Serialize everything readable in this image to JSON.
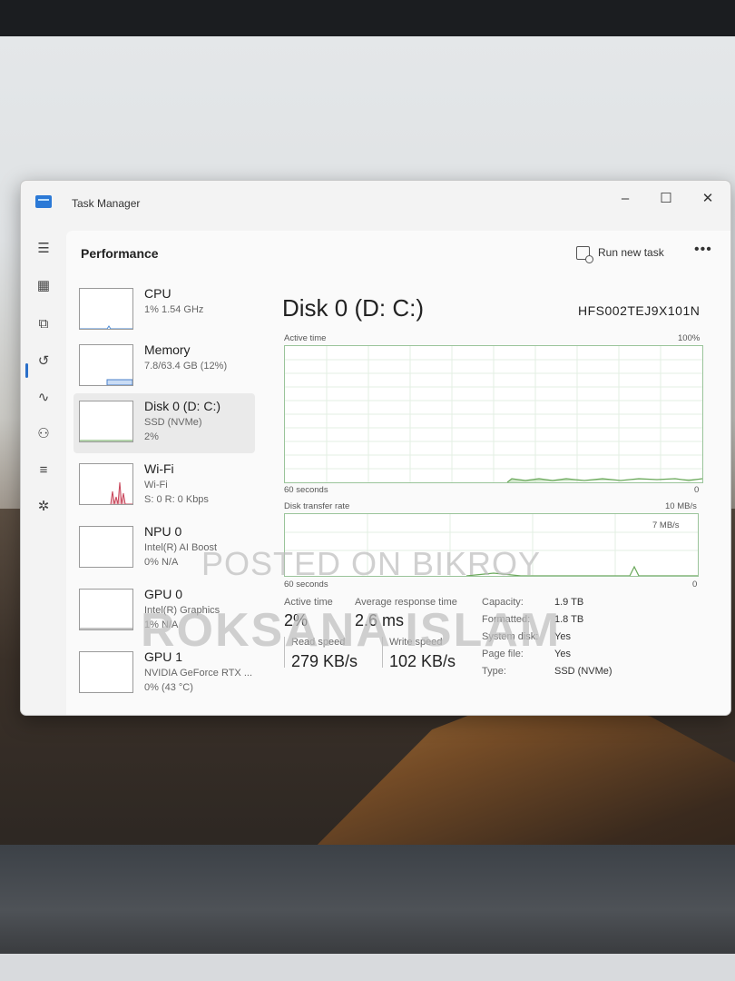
{
  "window": {
    "title": "Task Manager",
    "controls": {
      "minimize": "–",
      "maximize": "☐",
      "close": "✕"
    }
  },
  "header": {
    "title": "Performance",
    "run_new_task": "Run new task",
    "more": "•••"
  },
  "rail": {
    "items": [
      {
        "icon": "hamburger-icon",
        "glyph": "☰"
      },
      {
        "icon": "processes-icon",
        "glyph": "▦"
      },
      {
        "icon": "performance-icon",
        "glyph": "⧉"
      },
      {
        "icon": "app-history-icon",
        "glyph": "↺"
      },
      {
        "icon": "startup-apps-icon",
        "glyph": "∿"
      },
      {
        "icon": "users-icon",
        "glyph": "⚇"
      },
      {
        "icon": "details-icon",
        "glyph": "≡"
      },
      {
        "icon": "services-icon",
        "glyph": "✲"
      }
    ],
    "settings_glyph": "⚙"
  },
  "devices": [
    {
      "name": "CPU",
      "sub": "1% 1.54 GHz",
      "sub2": ""
    },
    {
      "name": "Memory",
      "sub": "7.8/63.4 GB (12%)",
      "sub2": ""
    },
    {
      "name": "Disk 0 (D: C:)",
      "sub": "SSD (NVMe)",
      "sub2": "2%"
    },
    {
      "name": "Wi-Fi",
      "sub": "Wi-Fi",
      "sub2": "S: 0 R: 0 Kbps"
    },
    {
      "name": "NPU 0",
      "sub": "Intel(R) AI Boost",
      "sub2": "0% N/A"
    },
    {
      "name": "GPU 0",
      "sub": "Intel(R) Graphics",
      "sub2": "1% N/A"
    },
    {
      "name": "GPU 1",
      "sub": "NVIDIA GeForce RTX ...",
      "sub2": "0% (43 °C)"
    }
  ],
  "detail": {
    "title": "Disk 0 (D: C:)",
    "model": "HFS002TEJ9X101N",
    "active_time_label": "Active time",
    "active_time_max": "100%",
    "graph1_left": "60 seconds",
    "graph1_right": "0",
    "transfer_label": "Disk transfer rate",
    "transfer_max": "10 MB/s",
    "transfer_inner": "7 MB/s",
    "graph2_left": "60 seconds",
    "graph2_right": "0"
  },
  "stats": {
    "active_time_label": "Active time",
    "active_time_value": "2%",
    "response_label": "Average response time",
    "response_value": "2.6 ms",
    "read_label": "Read speed",
    "read_value": "279 KB/s",
    "write_label": "Write speed",
    "write_value": "102 KB/s",
    "props": [
      {
        "label": "Capacity:",
        "value": "1.9 TB"
      },
      {
        "label": "Formatted:",
        "value": "1.8 TB"
      },
      {
        "label": "System disk:",
        "value": "Yes"
      },
      {
        "label": "Page file:",
        "value": "Yes"
      },
      {
        "label": "Type:",
        "value": "SSD (NVMe)"
      }
    ]
  },
  "watermark": {
    "line1": "POSTED ON BIKROY",
    "line2": "ROKSANA ISLAM"
  }
}
